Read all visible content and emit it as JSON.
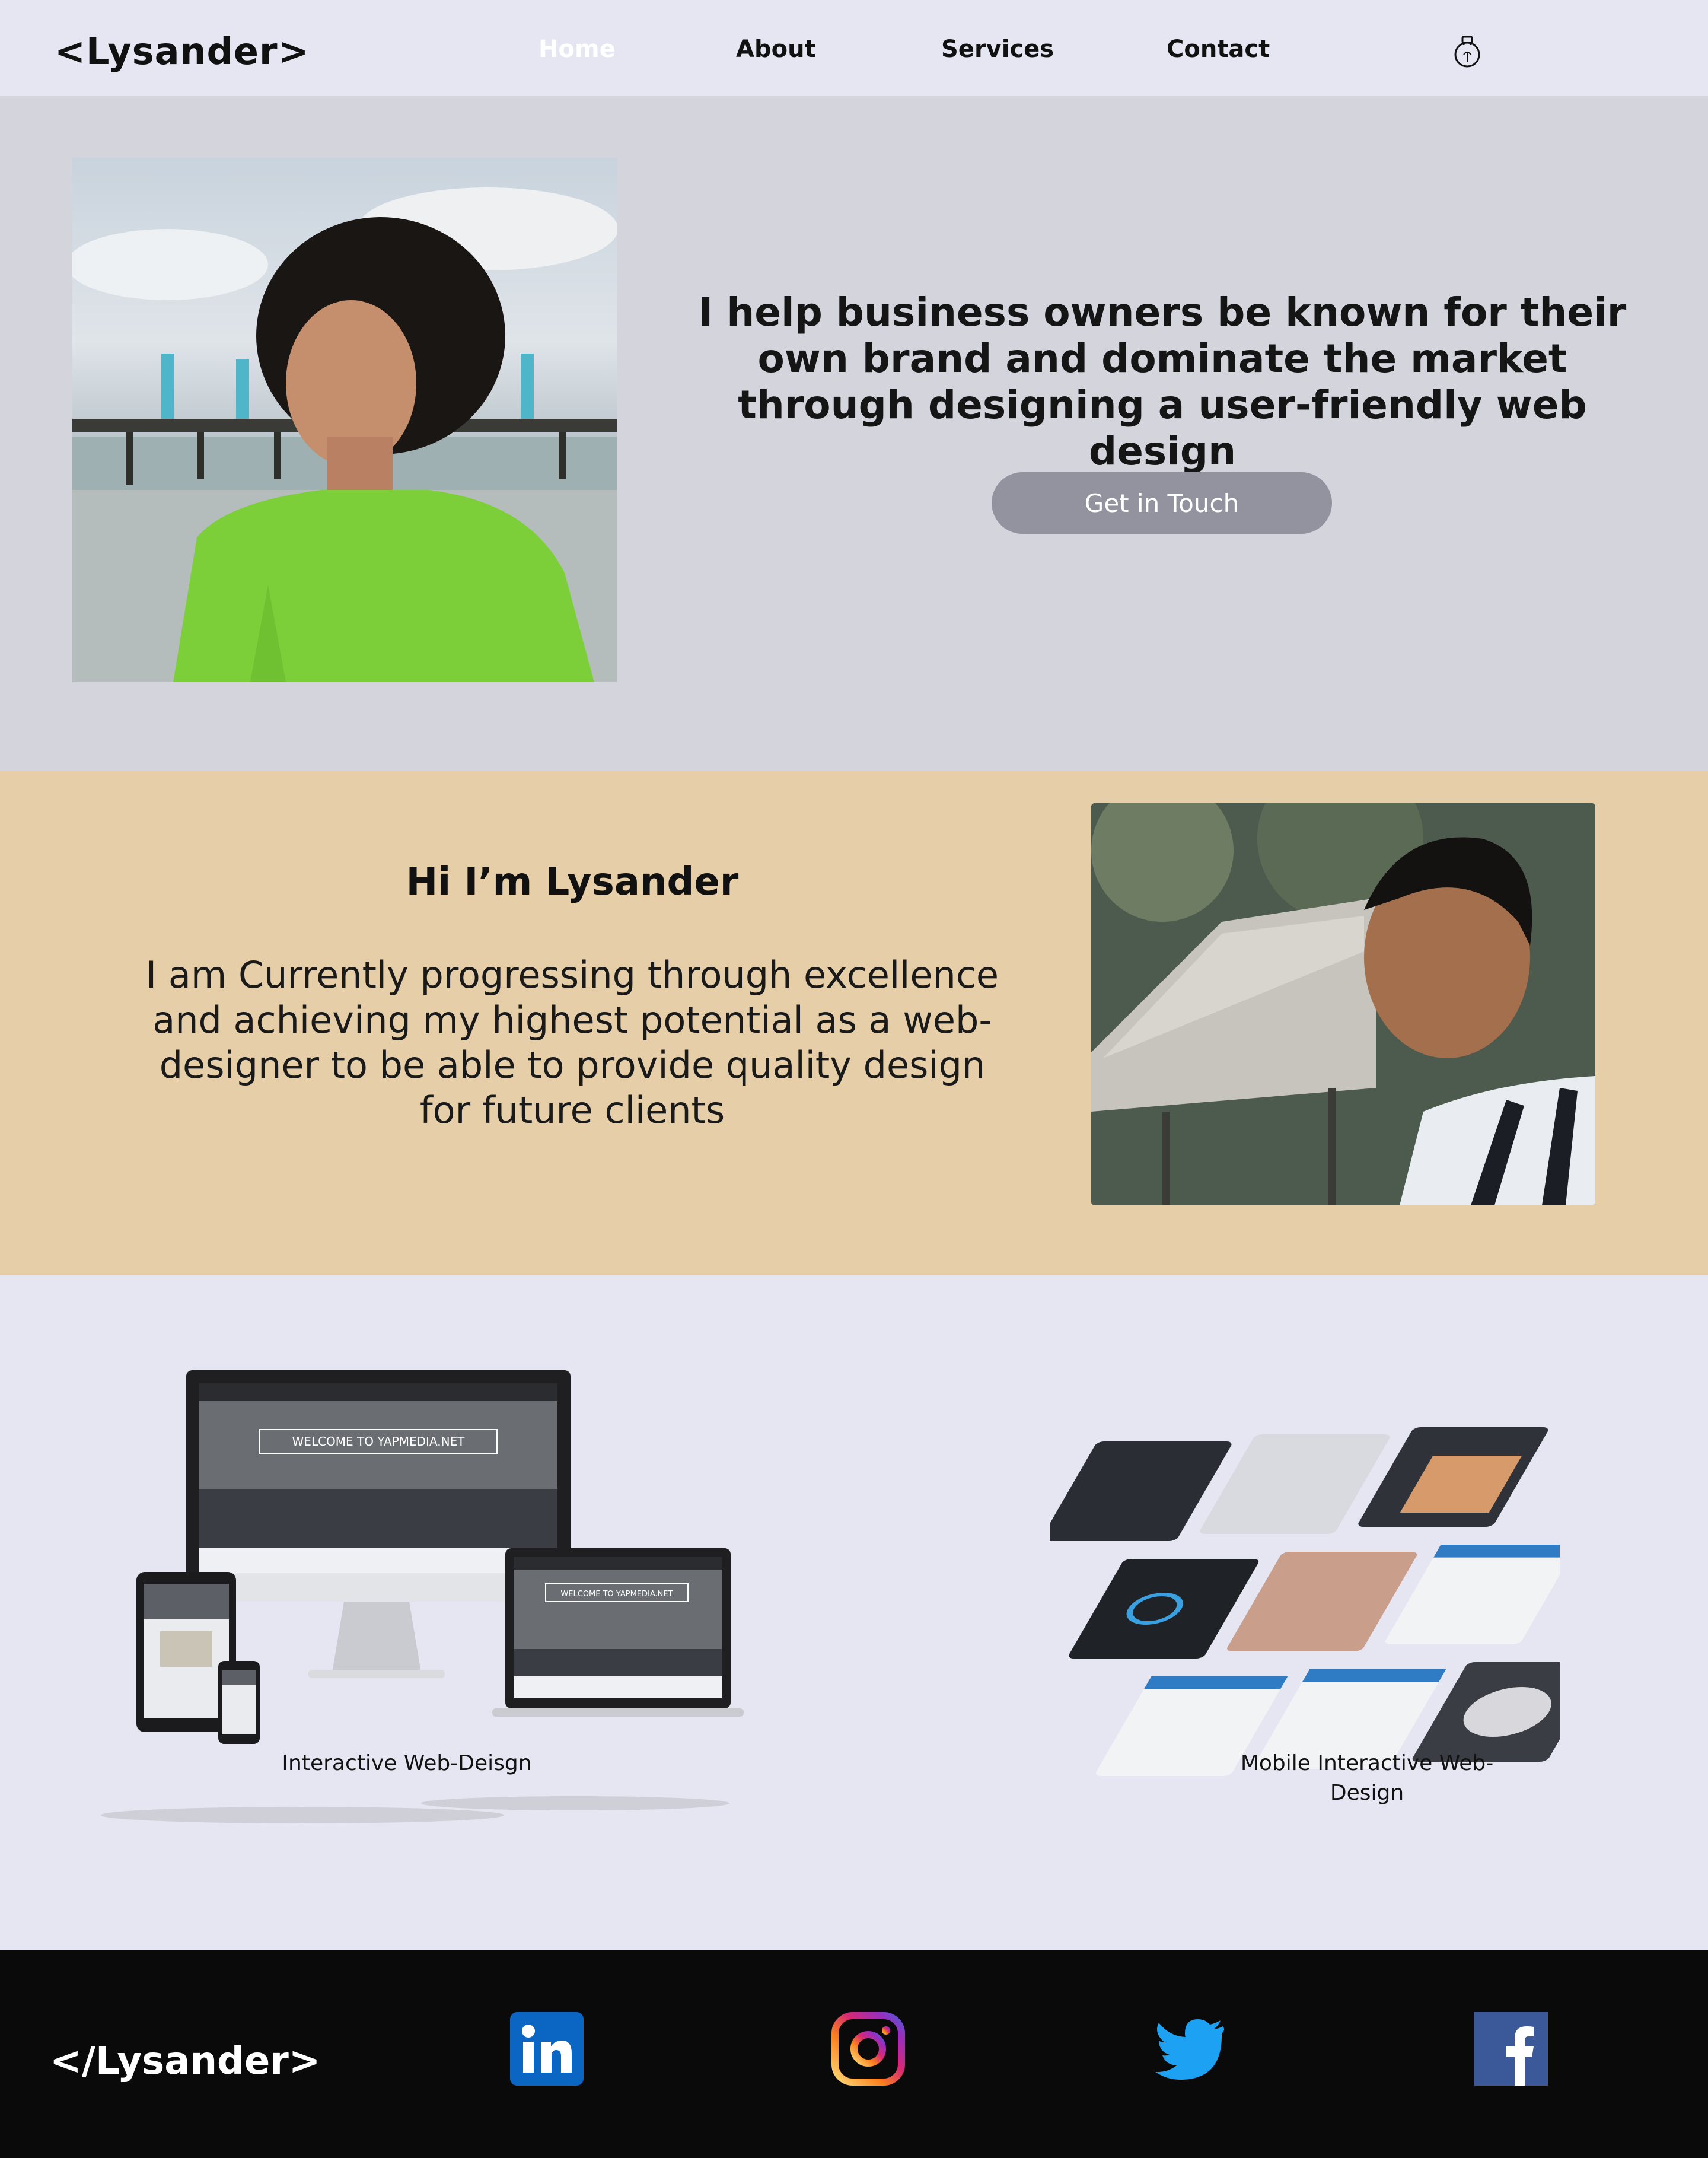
{
  "nav": {
    "logo": "<Lysander>",
    "links": [
      {
        "label": "Home",
        "active": true
      },
      {
        "label": "About",
        "active": false
      },
      {
        "label": "Services",
        "active": false
      },
      {
        "label": "Contact",
        "active": false
      }
    ],
    "theme_icon": "lightbulb-icon"
  },
  "hero": {
    "headline": "I help business owners be known for their own brand and dominate the market through designing a user-friendly web design",
    "cta_label": "Get in Touch"
  },
  "about": {
    "title": "Hi I’m Lysander",
    "body": "I am Currently progressing through excellence and achieving my highest potential as a web-designer to be able to provide quality design for future clients"
  },
  "services": {
    "items": [
      {
        "caption": "Interactive Web-Deisgn",
        "mockup_text": "WELCOME TO YAPMEDIA.NET"
      },
      {
        "caption": "Mobile Interactive Web-Design"
      }
    ]
  },
  "footer": {
    "logo": "</Lysander>",
    "socials": [
      {
        "name": "linkedin-icon",
        "color": "#0a66c2"
      },
      {
        "name": "instagram-icon",
        "color": "#e1306c"
      },
      {
        "name": "twitter-icon",
        "color": "#1da1f2"
      },
      {
        "name": "facebook-icon",
        "color": "#3b5998"
      }
    ]
  },
  "colors": {
    "nav_bg": "#e6e6f2",
    "hero_bg": "#d4d4dd",
    "about_bg": "#e5cea8",
    "cta_bg": "#93939f",
    "footer_bg": "#0a0a0a"
  }
}
